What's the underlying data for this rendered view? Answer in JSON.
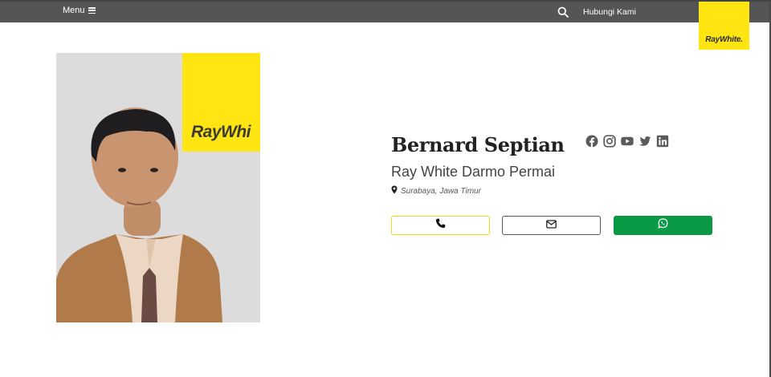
{
  "header": {
    "menu_label": "Menu",
    "contact_label": "Hubungi Kami",
    "logo_text": "RayWhite."
  },
  "photo": {
    "banner_text": "RayWhi"
  },
  "agent": {
    "name": "Bernard Septian",
    "office": "Ray White Darmo Permai",
    "location": "Surabaya, Jawa Timur"
  },
  "socials": [
    "facebook-icon",
    "instagram-icon",
    "youtube-icon",
    "twitter-icon",
    "linkedin-icon"
  ],
  "buttons": {
    "phone_icon": "phone-icon",
    "email_icon": "envelope-icon",
    "whatsapp_icon": "whatsapp-icon"
  },
  "colors": {
    "topbar": "#555555",
    "brand_yellow": "#ffe512",
    "whatsapp_green": "#0a9a45"
  }
}
